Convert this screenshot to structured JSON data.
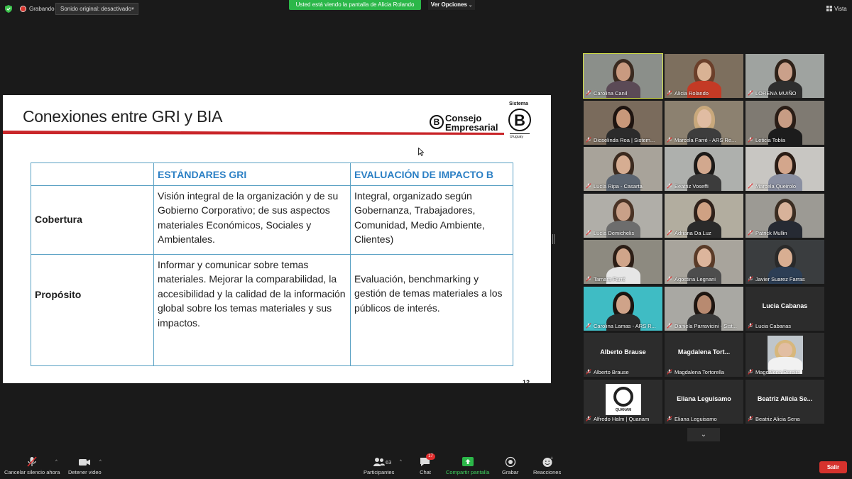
{
  "topbar": {
    "recording_label": "Grabando",
    "sound_button": "Sonido original: desactivado",
    "sharing_banner": "Usted está viendo la pantalla de Alicia Rolando",
    "view_options": "Ver Opciones",
    "view_label": "Vista"
  },
  "slide": {
    "title": "Conexiones entre GRI y BIA",
    "logo_consejo": [
      "Consejo",
      "Empresarial"
    ],
    "logo_sistema_top": "Sistema",
    "logo_sistema_bottom": "Uruguay",
    "logo_b_letter": "B",
    "page_number": "12",
    "table": {
      "headers": [
        "",
        "ESTÁNDARES GRI",
        "EVALUACIÓN DE IMPACTO B"
      ],
      "rows": [
        {
          "label": "Cobertura",
          "gri": "Visión integral de la organización y de su Gobierno Corporativo; de sus aspectos materiales Económicos, Sociales y Ambientales.",
          "bia": "Integral, organizado según Gobernanza, Trabajadores, Comunidad, Medio Ambiente, Clientes)"
        },
        {
          "label": "Propósito",
          "gri": "Informar y comunicar sobre temas materiales. Mejorar la comparabilidad, la accesibilidad y la calidad de la información global sobre los temas materiales y sus impactos.",
          "bia": "Evaluación, benchmarking y gestión de temas materiales a los públicos de interés."
        }
      ]
    }
  },
  "participants": [
    {
      "name": "Carolina Canil",
      "video": true,
      "active": true,
      "bg": "#8b8f8a",
      "skin": "#c99a80",
      "hair": "#3a2a20",
      "top": "#5b4a56"
    },
    {
      "name": "Alicia Rolando",
      "video": true,
      "bg": "#7d6f5e",
      "skin": "#d9b294",
      "hair": "#6b3f2a",
      "top": "#c43a25"
    },
    {
      "name": "LORENA MUIÑO",
      "video": true,
      "bg": "#9fa3a0",
      "skin": "#caa08a",
      "hair": "#2e2118",
      "top": "#2e2e2e"
    },
    {
      "name": "Dioselinda Roa | Sistem...",
      "video": true,
      "bg": "#7a6b5c",
      "skin": "#c8987a",
      "hair": "#1e1410",
      "top": "#2b2b2b"
    },
    {
      "name": "Marcela Farré - ARS Re...",
      "video": true,
      "bg": "#8c8170",
      "skin": "#e0bca2",
      "hair": "#c9a97c",
      "top": "#3d3d3d"
    },
    {
      "name": "Leticia Tobía",
      "video": true,
      "bg": "#7f7a72",
      "skin": "#c79c84",
      "hair": "#2a1d16",
      "top": "#1c1c1c"
    },
    {
      "name": "Lucía Ripa - Casarta",
      "video": true,
      "bg": "#a8a39a",
      "skin": "#d6ad92",
      "hair": "#3b2a1f",
      "top": "#5b6470"
    },
    {
      "name": "Beatriz Voseffi",
      "video": true,
      "bg": "#aeb0ad",
      "skin": "#d2a88e",
      "hair": "#1d1a18",
      "top": "#3c3c3c"
    },
    {
      "name": "Marcela Queirolo",
      "video": true,
      "bg": "#c8c6c2",
      "skin": "#d3a68c",
      "hair": "#2a1c15",
      "top": "#8a8fa1"
    },
    {
      "name": "Lucía Demichelis",
      "video": true,
      "bg": "#b0aea8",
      "skin": "#c9a088",
      "hair": "#4a3325",
      "top": "#6d6d6d"
    },
    {
      "name": "Adriana Da Luz",
      "video": true,
      "bg": "#b2ad9f",
      "skin": "#cfa183",
      "hair": "#2f211a",
      "top": "#2a2a2a"
    },
    {
      "name": "Patrick Mullin",
      "video": true,
      "bg": "#9c9a94",
      "skin": "#d8b29a",
      "hair": "#3b2d22",
      "top": "#262a33"
    },
    {
      "name": "Tamara Farré",
      "video": true,
      "bg": "#8d8a80",
      "skin": "#d0a58a",
      "hair": "#2c1e16",
      "top": "#e6e6e6"
    },
    {
      "name": "Agostina Legnani",
      "video": true,
      "bg": "#a8a49c",
      "skin": "#dcb59c",
      "hair": "#5a3b28",
      "top": "#4d4d4d"
    },
    {
      "name": "Javier Suarez Farras",
      "video": true,
      "bg": "#3a3d3f",
      "skin": "#d8ae92",
      "hair": "#2a2a2a",
      "top": "#2c3e55"
    },
    {
      "name": "Carolina Lamas - ARS R...",
      "video": true,
      "bg": "#3fbcc4",
      "skin": "#cfa389",
      "hair": "#1b1410",
      "top": "#2b2b2b"
    },
    {
      "name": "Daniela Parravicini - Sist...",
      "video": true,
      "bg": "#a9a8a3",
      "skin": "#b88a70",
      "hair": "#1f1611",
      "top": "#3a3a3a"
    },
    {
      "name": "Lucia Cabanas",
      "video": false,
      "display": "Lucia Cabanas"
    },
    {
      "name": "Alberto Brause",
      "video": false,
      "display": "Alberto Brause"
    },
    {
      "name": "Magdalena Tortorella",
      "video": false,
      "display": "Magdalena  Tort..."
    },
    {
      "name": "Magdalena Pereira",
      "video": false,
      "photo": true,
      "bg": "#bfc6cc",
      "skin": "#e2bea2",
      "hair": "#d7b77c",
      "top": "#f1f1f1"
    },
    {
      "name": "Alfredo Halm | Quanam",
      "video": false,
      "logo": "QUANAM"
    },
    {
      "name": "Eliana Leguisamo",
      "video": false,
      "display": "Eliana Leguisamo"
    },
    {
      "name": "Beatriz Alicia Sena",
      "video": false,
      "display": "Beatriz  Alicia  Se..."
    }
  ],
  "toolbar": {
    "mute_label": "Cancelar silencio ahora",
    "video_label": "Detener video",
    "participants_label": "Participantes",
    "participants_count": "63",
    "chat_label": "Chat",
    "chat_badge": "17",
    "share_label": "Compartir pantalla",
    "record_label": "Grabar",
    "reactions_label": "Reacciones",
    "exit_label": "Salir"
  },
  "colors": {
    "share_green": "#2bb749",
    "exit_red": "#d6322d",
    "table_border": "#5aa1c4",
    "table_header_text": "#2b7fc4",
    "slide_rule_red": "#c9262a",
    "active_speaker": "#d6e34a"
  }
}
